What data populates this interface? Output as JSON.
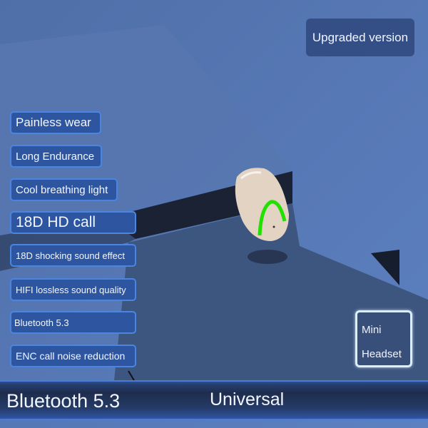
{
  "product": {
    "badge": "Upgraded version",
    "features": [
      {
        "label": "Painless wear"
      },
      {
        "label": "Long Endurance"
      },
      {
        "label": "Cool breathing light"
      },
      {
        "label": "18D HD call"
      },
      {
        "label": "18D shocking sound effect"
      },
      {
        "label": "HIFI lossless sound quality"
      },
      {
        "label": "Bluetooth 5.3"
      },
      {
        "label": "ENC call noise reduction"
      }
    ],
    "type_box": {
      "line1": "Mini",
      "line2": "Headset"
    },
    "bottom_bar": {
      "left": "Bluetooth 5.3",
      "right": "Universal"
    },
    "colors": {
      "tag_fill": "#2e56a0",
      "tag_border": "#4a86e0",
      "background": "#5a7bb5",
      "breathing_light": "#22e000"
    }
  }
}
